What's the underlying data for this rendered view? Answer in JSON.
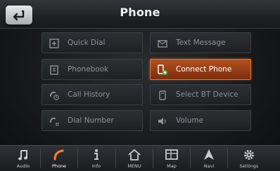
{
  "header": {
    "title": "Phone"
  },
  "menu": {
    "items": [
      {
        "label": "Quick Dial",
        "icon": "quick-dial-icon"
      },
      {
        "label": "Text Message",
        "icon": "text-message-icon"
      },
      {
        "label": "Phonebook",
        "icon": "phonebook-icon"
      },
      {
        "label": "Connect Phone",
        "icon": "connect-phone-icon",
        "active": true
      },
      {
        "label": "Call History",
        "icon": "call-history-icon"
      },
      {
        "label": "Select BT Device",
        "icon": "bluetooth-device-icon"
      },
      {
        "label": "Dial Number",
        "icon": "dial-number-icon"
      },
      {
        "label": "Volume",
        "icon": "volume-icon"
      }
    ]
  },
  "nav": {
    "items": [
      {
        "label": "Audio",
        "icon": "music-note-icon"
      },
      {
        "label": "Phone",
        "icon": "phone-icon",
        "active": true
      },
      {
        "label": "Info",
        "icon": "info-icon"
      },
      {
        "label": "MENU",
        "icon": "home-icon"
      },
      {
        "label": "Map",
        "icon": "map-icon"
      },
      {
        "label": "Navi",
        "icon": "navigation-arrow-icon"
      },
      {
        "label": "Settings",
        "icon": "gear-icon"
      }
    ]
  },
  "colors": {
    "accent": "#b5511f",
    "active_icon": "#ff7a2a"
  }
}
